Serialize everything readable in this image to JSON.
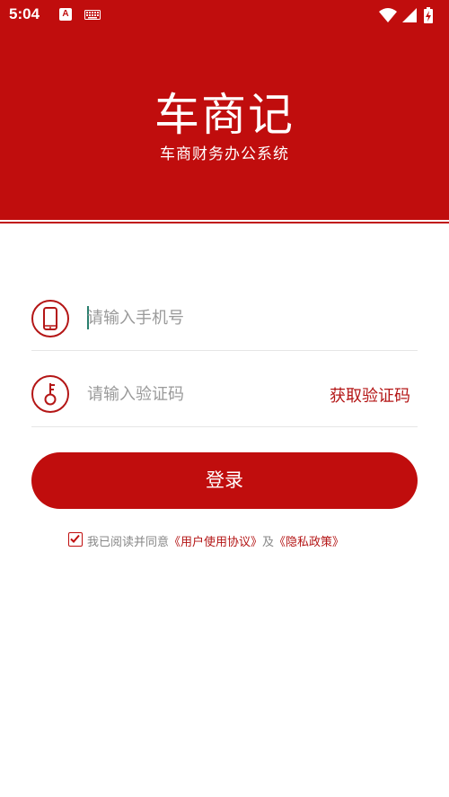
{
  "status_bar": {
    "time": "5:04",
    "icons": [
      "a-letter-icon",
      "keyboard-icon",
      "wifi-icon",
      "signal-icon",
      "battery-icon"
    ]
  },
  "brand": {
    "title": "车商记",
    "subtitle": "车商财务办公系统"
  },
  "form": {
    "phone_placeholder": "请输入手机号",
    "phone_value": "",
    "code_placeholder": "请输入验证码",
    "code_value": "",
    "get_code_label": "获取验证码",
    "login_label": "登录"
  },
  "agreement": {
    "checked": true,
    "prefix": "我已阅读并同意",
    "user_agreement": "《用户使用协议》",
    "and": "及",
    "privacy_policy": "《隐私政策》"
  },
  "colors": {
    "brand_red": "#c00d0d",
    "accent_red": "#b41616",
    "placeholder_gray": "#9a9a9a"
  }
}
